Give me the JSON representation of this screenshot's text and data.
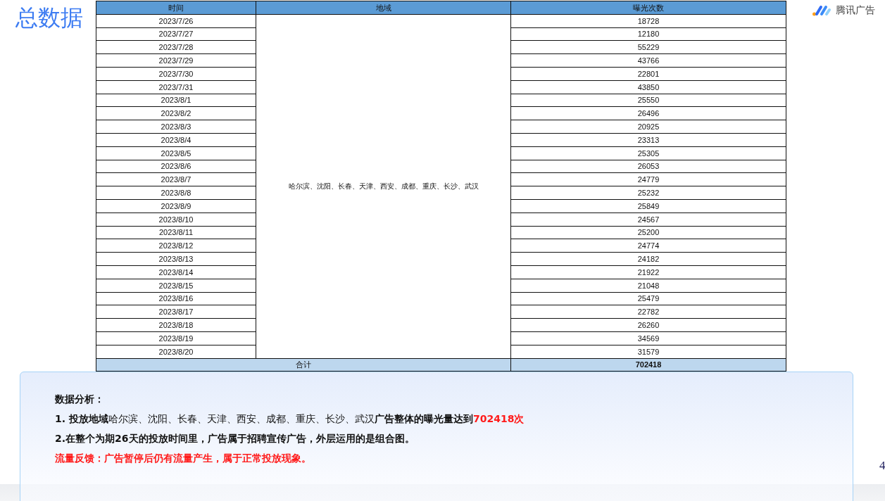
{
  "title": "总数据",
  "logo": {
    "text": "腾讯广告"
  },
  "table": {
    "columns": [
      "时间",
      "地域",
      "曝光次数"
    ],
    "region": "哈尔滨、沈阳、长春、天津、西安、成都、重庆、长沙、武汉",
    "rows": [
      {
        "date": "2023/7/26",
        "exposure": "18728"
      },
      {
        "date": "2023/7/27",
        "exposure": "12180"
      },
      {
        "date": "2023/7/28",
        "exposure": "55229"
      },
      {
        "date": "2023/7/29",
        "exposure": "43766"
      },
      {
        "date": "2023/7/30",
        "exposure": "22801"
      },
      {
        "date": "2023/7/31",
        "exposure": "43850"
      },
      {
        "date": "2023/8/1",
        "exposure": "25550"
      },
      {
        "date": "2023/8/2",
        "exposure": "26496"
      },
      {
        "date": "2023/8/3",
        "exposure": "20925"
      },
      {
        "date": "2023/8/4",
        "exposure": "23313"
      },
      {
        "date": "2023/8/5",
        "exposure": "25305"
      },
      {
        "date": "2023/8/6",
        "exposure": "26053"
      },
      {
        "date": "2023/8/7",
        "exposure": "24779"
      },
      {
        "date": "2023/8/8",
        "exposure": "25232"
      },
      {
        "date": "2023/8/9",
        "exposure": "25849"
      },
      {
        "date": "2023/8/10",
        "exposure": "24567"
      },
      {
        "date": "2023/8/11",
        "exposure": "25200"
      },
      {
        "date": "2023/8/12",
        "exposure": "24774"
      },
      {
        "date": "2023/8/13",
        "exposure": "24182"
      },
      {
        "date": "2023/8/14",
        "exposure": "21922"
      },
      {
        "date": "2023/8/15",
        "exposure": "21048"
      },
      {
        "date": "2023/8/16",
        "exposure": "25479"
      },
      {
        "date": "2023/8/17",
        "exposure": "22782"
      },
      {
        "date": "2023/8/18",
        "exposure": "26260"
      },
      {
        "date": "2023/8/19",
        "exposure": "34569"
      },
      {
        "date": "2023/8/20",
        "exposure": "31579"
      }
    ],
    "total": {
      "label": "合计",
      "value": "702418"
    }
  },
  "analysis": {
    "heading": "数据分析：",
    "lines": [
      {
        "kind": "plain",
        "parts": [
          {
            "kind": "bold",
            "text": "1. 投放地域"
          },
          {
            "kind": "normal",
            "text": "哈尔滨、沈阳、长春、天津、西安、成都、重庆、长沙、武汉"
          },
          {
            "kind": "bold",
            "text": "广告整体的曝光量达到"
          },
          {
            "kind": "highlight",
            "text": "702418次"
          }
        ]
      },
      {
        "kind": "plain",
        "parts": [
          {
            "kind": "bold",
            "text": "2.在整个为期26天的投放时间里，广告属于招聘宣传广告，外层运用的是组合图。"
          }
        ]
      },
      {
        "kind": "alert",
        "parts": [
          {
            "kind": "highlight",
            "text": "流量反馈：广告暂停后仍有流量产生，属于正常投放现象。"
          }
        ]
      }
    ]
  },
  "page_number": "4"
}
